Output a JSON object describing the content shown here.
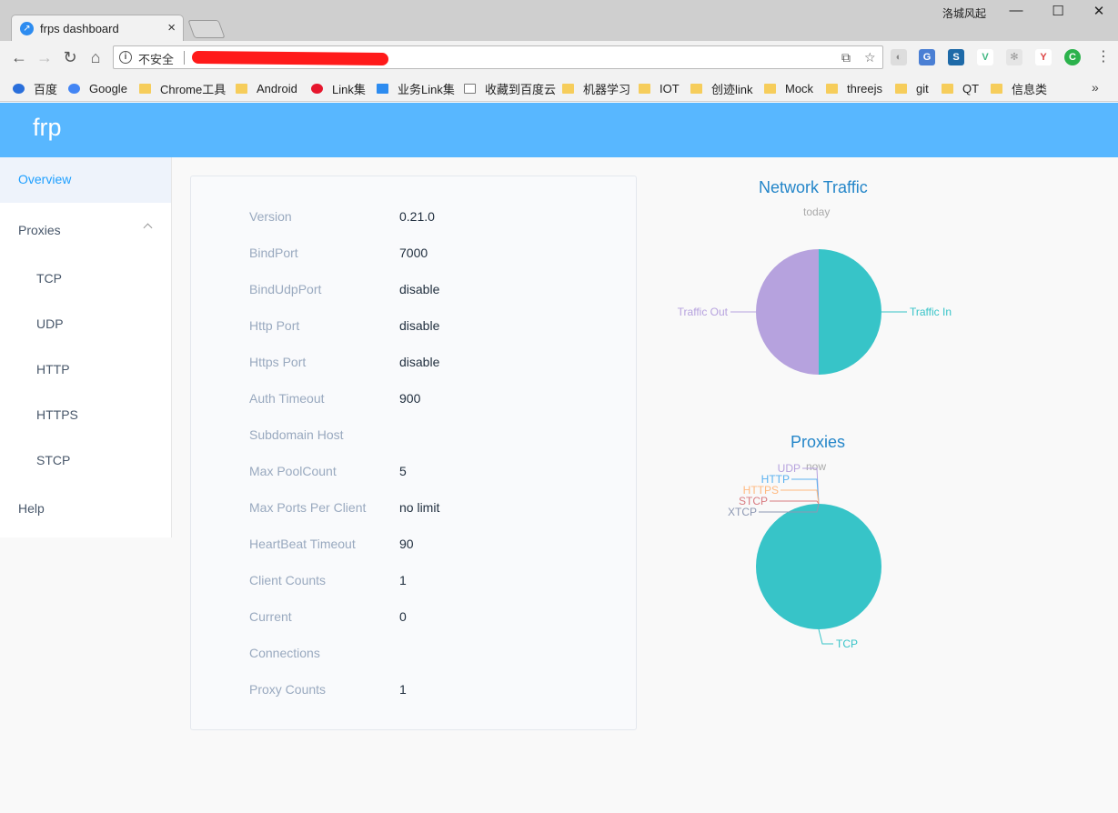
{
  "browser": {
    "tab_title": "frps dashboard",
    "tab_favicon": "frp-icon",
    "window_user": "洛城风起",
    "security_label": "不安全"
  },
  "bookmarks": [
    {
      "label": "百度",
      "icon": "baidu-paw-icon"
    },
    {
      "label": "Google",
      "icon": "google-g-icon"
    },
    {
      "label": "Chrome工具",
      "icon": "folder-icon"
    },
    {
      "label": "Android",
      "icon": "folder-icon"
    },
    {
      "label": "Link集",
      "icon": "weibo-icon"
    },
    {
      "label": "业务Link集",
      "icon": "cloud-icon"
    },
    {
      "label": "收藏到百度云",
      "icon": "page-icon"
    },
    {
      "label": "机器学习",
      "icon": "folder-icon"
    },
    {
      "label": "IOT",
      "icon": "folder-icon"
    },
    {
      "label": "创迹link",
      "icon": "folder-icon"
    },
    {
      "label": "Mock",
      "icon": "folder-icon"
    },
    {
      "label": "threejs",
      "icon": "folder-icon"
    },
    {
      "label": "git",
      "icon": "folder-icon"
    },
    {
      "label": "QT",
      "icon": "folder-icon"
    },
    {
      "label": "信息类",
      "icon": "folder-icon"
    }
  ],
  "app": {
    "title": "frp",
    "header_color": "#58b7ff"
  },
  "sidebar": {
    "items": [
      {
        "label": "Overview",
        "active": true
      },
      {
        "label": "Proxies",
        "expanded": true
      },
      {
        "label": "TCP"
      },
      {
        "label": "UDP"
      },
      {
        "label": "HTTP"
      },
      {
        "label": "HTTPS"
      },
      {
        "label": "STCP"
      },
      {
        "label": "Help"
      }
    ]
  },
  "server_info": [
    {
      "label": "Version",
      "value": "0.21.0"
    },
    {
      "label": "BindPort",
      "value": "7000"
    },
    {
      "label": "BindUdpPort",
      "value": "disable"
    },
    {
      "label": "Http Port",
      "value": "disable"
    },
    {
      "label": "Https Port",
      "value": "disable"
    },
    {
      "label": "Auth Timeout",
      "value": "900"
    },
    {
      "label": "Subdomain Host",
      "value": ""
    },
    {
      "label": "Max PoolCount",
      "value": "5"
    },
    {
      "label": "Max Ports Per Client",
      "value": "no limit"
    },
    {
      "label": "HeartBeat Timeout",
      "value": "90"
    },
    {
      "label": "Client Counts",
      "value": "1"
    },
    {
      "label": "Current",
      "value": "0"
    },
    {
      "label": "Connections",
      "value": ""
    },
    {
      "label": "Proxy Counts",
      "value": "1"
    }
  ],
  "chart_data": [
    {
      "type": "pie",
      "title": "Network Traffic",
      "subtitle": "today",
      "categories": [
        "Traffic In",
        "Traffic Out"
      ],
      "values": [
        50,
        50
      ],
      "colors": [
        "#37c4c8",
        "#b6a2de"
      ]
    },
    {
      "type": "pie",
      "title": "Proxies",
      "subtitle": "now",
      "categories": [
        "TCP",
        "UDP",
        "HTTP",
        "HTTPS",
        "STCP",
        "XTCP"
      ],
      "values": [
        1,
        0,
        0,
        0,
        0,
        0
      ],
      "colors": [
        "#37c4c8",
        "#b6a2de",
        "#5ab1ef",
        "#ffb980",
        "#d87a80",
        "#8d98b3"
      ]
    }
  ]
}
